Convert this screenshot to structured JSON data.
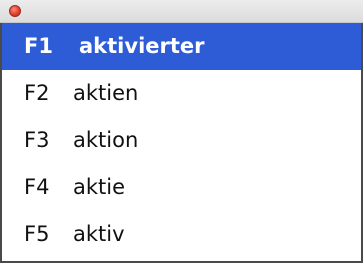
{
  "window": {
    "close_button": "close-button",
    "accent_color": "#2d5cd6"
  },
  "suggestions": [
    {
      "key": "F1",
      "word": "aktivierter",
      "selected": true
    },
    {
      "key": "F2",
      "word": "aktien",
      "selected": false
    },
    {
      "key": "F3",
      "word": "aktion",
      "selected": false
    },
    {
      "key": "F4",
      "word": "aktie",
      "selected": false
    },
    {
      "key": "F5",
      "word": "aktiv",
      "selected": false
    }
  ]
}
